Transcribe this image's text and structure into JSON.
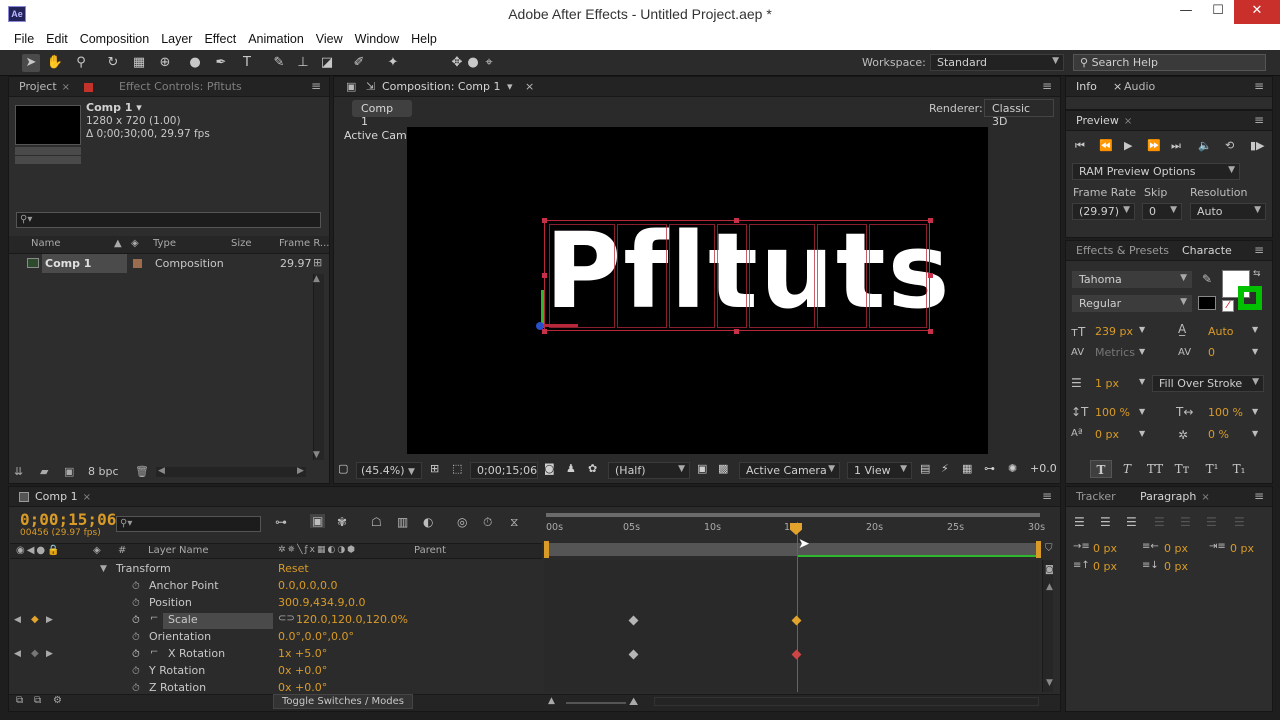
{
  "window": {
    "title": "Adobe After Effects - Untitled Project.aep *",
    "app_icon": "Ae",
    "minimize_icon": "—",
    "maximize_icon": "☐",
    "close_icon": "✕"
  },
  "menu": [
    "File",
    "Edit",
    "Composition",
    "Layer",
    "Effect",
    "Animation",
    "View",
    "Window",
    "Help"
  ],
  "toolbar": {
    "workspace_label": "Workspace:",
    "workspace_value": "Standard",
    "search_placeholder": "Search Help"
  },
  "project_panel": {
    "tab_project": "Project",
    "tab_effect_controls": "Effect Controls: Pfltuts",
    "comp_name": "Comp 1 ▾",
    "comp_size": "1280 x 720 (1.00)",
    "comp_duration": "Δ 0;00;30;00, 29.97 fps",
    "columns": [
      "Name",
      "Type",
      "Size",
      "Frame R..."
    ],
    "items": [
      {
        "name": "Comp 1",
        "type": "Composition",
        "size": "",
        "frame_rate": "29.97"
      }
    ],
    "bpc": "8 bpc"
  },
  "composition_panel": {
    "tab": "Composition: Comp 1",
    "subtab": "Comp 1",
    "renderer_label": "Renderer:",
    "renderer_value": "Classic 3D",
    "camera_label": "Active Camera",
    "text_layer": "Pfltuts",
    "zoom": "(45.4%)",
    "timecode": "0;00;15;06",
    "resolution": "(Half)",
    "view_camera": "Active Camera",
    "view_count": "1 View",
    "exposure": "+0.0"
  },
  "timeline_panel": {
    "tab": "Comp 1",
    "current_time": "0;00;15;06",
    "frame_info": "00456 (29.97 fps)",
    "col_layer_name": "Layer Name",
    "col_parent": "Parent",
    "col_number": "#",
    "toggle_label": "Toggle Switches / Modes",
    "ruler": [
      "00s",
      "05s",
      "10s",
      "15s",
      "20s",
      "25s",
      "30s"
    ],
    "properties": [
      {
        "name": "Transform",
        "value": "Reset"
      },
      {
        "name": "Anchor Point",
        "value": "0.0,0.0,0.0"
      },
      {
        "name": "Position",
        "value": "300.9,434.9,0.0"
      },
      {
        "name": "Scale",
        "value": "120.0,120.0,120.0%"
      },
      {
        "name": "Orientation",
        "value": "0.0°,0.0°,0.0°"
      },
      {
        "name": "X Rotation",
        "value": "1x +5.0°"
      },
      {
        "name": "Y Rotation",
        "value": "0x +0.0°"
      },
      {
        "name": "Z Rotation",
        "value": "0x +0.0°"
      }
    ]
  },
  "right_panels": {
    "tab_info": "Info",
    "tab_audio": "Audio",
    "tab_preview": "Preview",
    "ram_preview": "RAM Preview Options",
    "frame_rate_label": "Frame Rate",
    "skip_label": "Skip",
    "resolution_label": "Resolution",
    "frame_rate_value": "(29.97)",
    "skip_value": "0",
    "resolution_value": "Auto",
    "tab_effects": "Effects & Presets",
    "tab_character": "Characte",
    "font_family": "Tahoma",
    "font_style": "Regular",
    "font_size": "239 px",
    "leading": "Auto",
    "kerning": "Metrics",
    "tracking": "0",
    "stroke_width": "1 px",
    "stroke_mode": "Fill Over Stroke",
    "vert_scale": "100 %",
    "horiz_scale": "100 %",
    "baseline_shift": "0 px",
    "tsume": "0 %",
    "style_buttons": [
      "T",
      "T",
      "TT",
      "Tт",
      "T¹",
      "T₁"
    ],
    "tab_tracker": "Tracker",
    "tab_paragraph": "Paragraph",
    "para_indent_left": "0 px",
    "para_indent_right": "0 px",
    "para_indent_first": "0 px",
    "para_space_before": "0 px",
    "para_space_after": "0 px"
  },
  "colors": {
    "accent_orange": "#d99b27",
    "keyframe_selected": "#e2a42c",
    "bbox_red": "#b7283b",
    "fill_white": "#ffffff",
    "stroke_green": "#00c000",
    "close_red": "#c9302c"
  }
}
